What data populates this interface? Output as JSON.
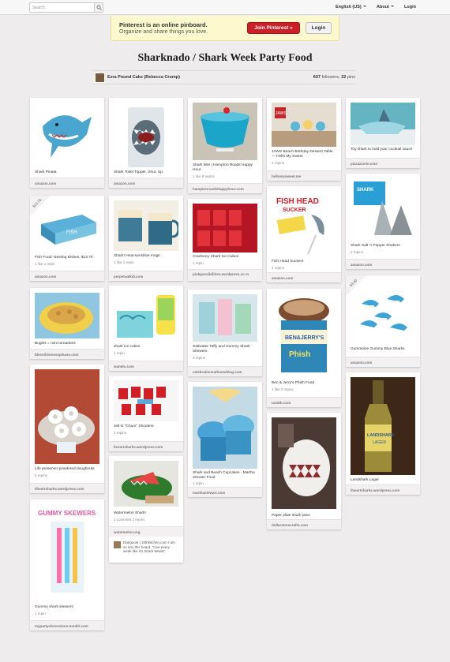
{
  "topbar": {
    "search_placeholder": "Search",
    "language": "English (US)",
    "about": "About",
    "login": "Login"
  },
  "banner": {
    "headline": "Pinterest is an online pinboard.",
    "subline": "Organize and share things you love.",
    "join_label": "Join Pinterest »",
    "login_label": "Login"
  },
  "board": {
    "title": "Sharknado / Shark Week Party Food",
    "owner": "Ezra Pound Cake (Rebecca Crump)",
    "followers": "607",
    "followers_label": "followers,",
    "pins": "22",
    "pins_label": "pins"
  },
  "pins": [
    {
      "id": "p1",
      "desc": "Shark Pinata",
      "stats": "",
      "source": "amazon.com"
    },
    {
      "id": "p2",
      "desc": "Shark Toilet Topper. Shut. Up.",
      "stats": "",
      "source": "amazon.com"
    },
    {
      "id": "p3",
      "desc": "Shark Bite | Hampton Roads Happy Hour",
      "stats": "1 like   8 repins",
      "source": "hamptonroadshappyhour.com"
    },
    {
      "id": "p4",
      "desc": "JAWS Beach Birthday Dessert Table — Hello My Sweet",
      "stats": "2 repins",
      "source": "hellomysweet.me"
    },
    {
      "id": "p5",
      "desc": "Toy shark to hold your cocktail sauce",
      "stats": "",
      "source": "pizzazzerie.com"
    },
    {
      "id": "p6",
      "desc": "Fish Food: Nesting Dishes, $13.70",
      "stats": "1 like   1 repin",
      "source": "amazon.com",
      "price": "$13.70"
    },
    {
      "id": "p7",
      "desc": "Shark! Heat-sensitive mugs",
      "stats": "1 like   1 repin",
      "source": "perpetualkid.com"
    },
    {
      "id": "p8",
      "desc": "Cranberry Shark Ice Cubes",
      "stats": "1 repin",
      "source": "pinkpossibilities.wordpress.co m"
    },
    {
      "id": "p9",
      "desc": "Fish Head Suckers",
      "stats": "2 repins",
      "source": "amazon.com"
    },
    {
      "id": "p10",
      "desc": "Shark Salt 'n Pepper Shakers",
      "stats": "2 repins",
      "source": "amazon.com"
    },
    {
      "id": "p11",
      "desc": "Bugles = mini tornadoes",
      "stats": "",
      "source": "blessthismessplease.com"
    },
    {
      "id": "p12",
      "desc": "shark ice cubes",
      "stats": "1 repin",
      "source": "wanelo.com"
    },
    {
      "id": "p13",
      "desc": "Saltwater Taffy and Gummy Shark Skewers",
      "stats": "3 repins",
      "source": "celebrationsathomeblog.com"
    },
    {
      "id": "p14",
      "desc": "Ben & Jerry's Phish Food",
      "stats": "1 like   2 repins",
      "source": "tumblr.com"
    },
    {
      "id": "p15",
      "desc": "Gummeize Gummy Blue Sharks",
      "stats": "",
      "source": "amazon.com",
      "price": "$3.40"
    },
    {
      "id": "p16",
      "desc": "Life preserver powdered doughnuts",
      "stats": "2 repins",
      "source": "ilheartsharks.wordpress.com"
    },
    {
      "id": "p17",
      "desc": "Jell-O \"Chum\" Shooters",
      "stats": "3 repins",
      "source": "ilveartsharks.wordpress.com"
    },
    {
      "id": "p18",
      "desc": "Shark and Beach Cupcakes - Martha Stewart Food",
      "stats": "1 repin",
      "source": "marthastewart.com"
    },
    {
      "id": "p19",
      "desc": "Landshark Lager",
      "stats": "",
      "source": "ilveartsharks.wordpress.com"
    },
    {
      "id": "p20",
      "desc": "Watermelon Shark!",
      "stats": "1 comment   2 repins",
      "source": "watermelon.org",
      "comment": "Danguole | 10thkitchen.com I am so into this board. \"Live every week like it's Shark Week!\""
    },
    {
      "id": "p21",
      "desc": "Paper plate shark jaws",
      "stats": "",
      "source": "dollarstorecrafts.com"
    },
    {
      "id": "p22",
      "desc": "Gummy shark skewers",
      "stats": "1 repin",
      "source": "mypartyobsessions.tumblr.com"
    }
  ],
  "colors": {
    "background": "#eeecec",
    "brand_red": "#cb2027",
    "banner_yellow": "#fdf8ce"
  }
}
